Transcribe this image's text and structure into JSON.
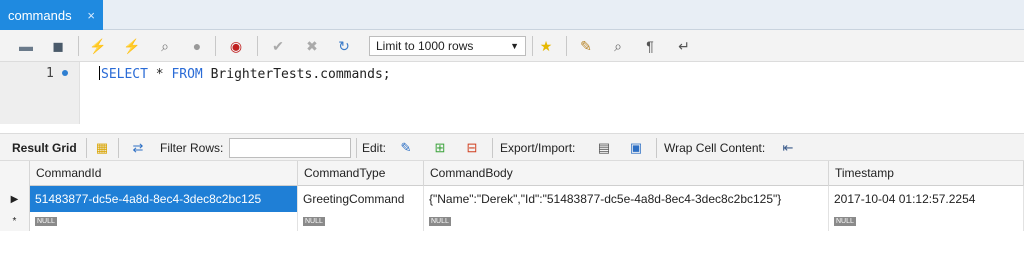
{
  "tab": {
    "title": "commands",
    "close_glyph": "×"
  },
  "toolbar": {
    "limit_label": "Limit to 1000 rows",
    "icons": [
      "open-folder-icon",
      "save-icon",
      "execute-icon",
      "execute-current-icon",
      "explain-icon",
      "stop-icon",
      "toggle-error-icon",
      "commit-icon",
      "rollback-icon",
      "autocommit-icon",
      "bookmark-star-icon",
      "beautify-icon",
      "find-icon",
      "invisible-chars-icon",
      "wrap-icon"
    ]
  },
  "editor": {
    "line_number": "1",
    "keyword1": "SELECT",
    "middle": " * ",
    "keyword2": "FROM",
    "rest": " BrighterTests.commands;"
  },
  "result_bar": {
    "result_grid": "Result Grid",
    "filter_rows": "Filter Rows:",
    "edit": "Edit:",
    "export_import": "Export/Import:",
    "wrap_cell": "Wrap Cell Content:"
  },
  "grid": {
    "columns": [
      "CommandId",
      "CommandType",
      "CommandBody",
      "Timestamp"
    ],
    "rows": [
      [
        "51483877-dc5e-4a8d-8ec4-3dec8c2bc125",
        "GreetingCommand",
        "{\"Name\":\"Derek\",\"Id\":\"51483877-dc5e-4a8d-8ec4-3dec8c2bc125\"}",
        "2017-10-04 01:12:57.2254"
      ]
    ],
    "null_label": "NULL",
    "row_marker": "▶",
    "new_row_marker": "*"
  },
  "colors": {
    "accent": "#1f8ae0",
    "selection": "#1f7fd6",
    "keyword": "#2a6bd6"
  }
}
